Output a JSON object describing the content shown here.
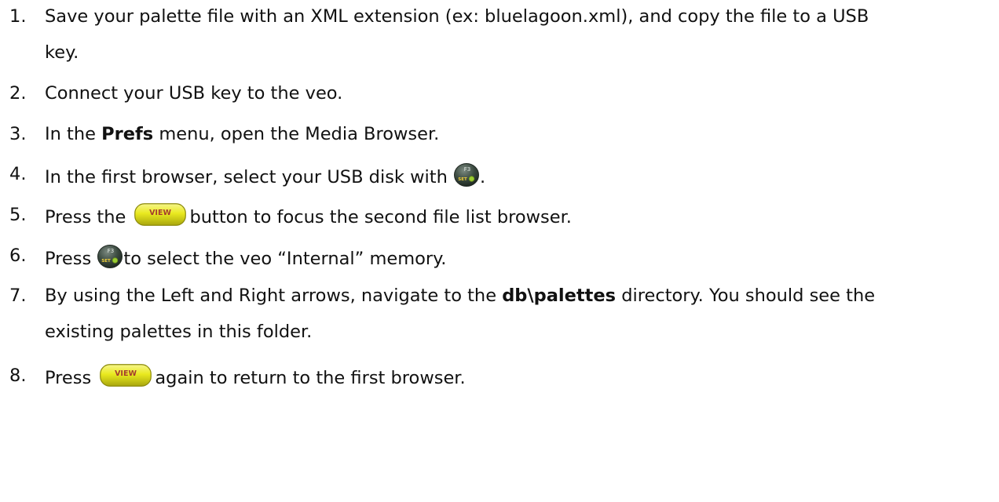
{
  "steps": [
    {
      "number": "1.",
      "line1": "Save your palette file with an XML extension (ex: bluelagoon.xml), and copy the file to a USB",
      "line2": "key."
    },
    {
      "number": "2.",
      "text": "Connect your USB key to the veo."
    },
    {
      "number": "3.",
      "pre": "In the ",
      "bold": "Prefs",
      "post": " menu, open the Media Browser."
    },
    {
      "number": "4.",
      "pre": "In the first browser, select your USB disk with",
      "post": "."
    },
    {
      "number": "5.",
      "pre": "Press the",
      "post": "button to focus the second file list browser."
    },
    {
      "number": "6.",
      "pre": "Press",
      "post": "to select the veo “Internal” memory."
    },
    {
      "number": "7.",
      "pre": "By using the Left and Right arrows, navigate to the ",
      "bold": "db\\palettes",
      "post": " directory.  You should see the",
      "line2": "existing palettes in this folder."
    },
    {
      "number": "8.",
      "pre": "Press",
      "post": "again to return to the first browser."
    }
  ],
  "icons": {
    "f3_key": {
      "name": "f3-set-key-icon",
      "top_label": "F3",
      "bottom_label": "SET",
      "color": "#3b4a40"
    },
    "view_key": {
      "name": "view-key-icon",
      "label": "VIEW",
      "color": "#e9e91f"
    }
  }
}
